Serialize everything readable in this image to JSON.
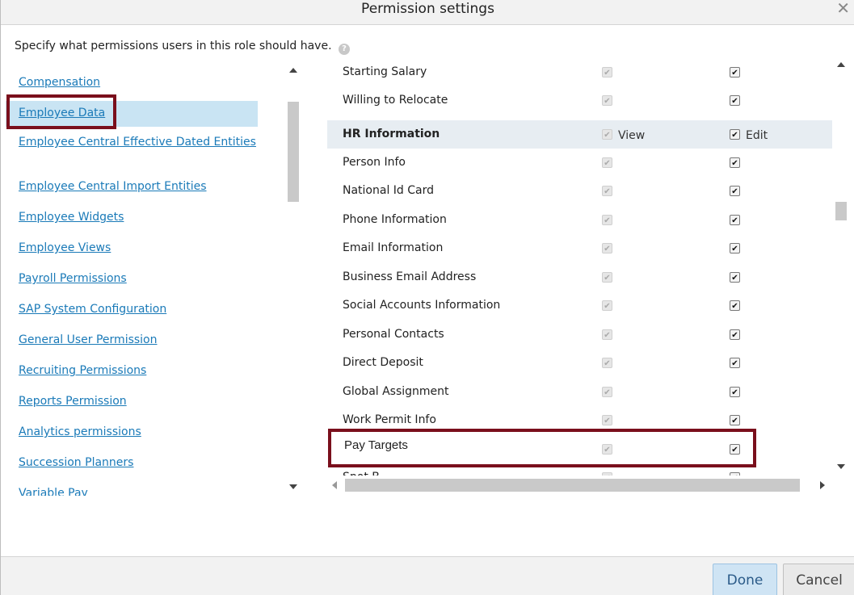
{
  "dialog": {
    "title": "Permission settings",
    "close_symbol": "✕",
    "intro": "Specify what permissions users in this role should have.",
    "help_symbol": "?"
  },
  "nav": {
    "items": [
      {
        "label": "Compensation",
        "selected": false
      },
      {
        "label": "Employee Data",
        "selected": true
      },
      {
        "label": "Employee Central Effective Dated Entities",
        "selected": false
      },
      {
        "label": "Employee Central Import Entities",
        "selected": false
      },
      {
        "label": "Employee Widgets",
        "selected": false
      },
      {
        "label": "Employee Views",
        "selected": false
      },
      {
        "label": "Payroll Permissions",
        "selected": false
      },
      {
        "label": "SAP System Configuration",
        "selected": false
      },
      {
        "label": "General User Permission",
        "selected": false
      },
      {
        "label": "Recruiting Permissions",
        "selected": false
      },
      {
        "label": "Reports Permission",
        "selected": false
      },
      {
        "label": "Analytics permissions",
        "selected": false
      },
      {
        "label": "Succession Planners",
        "selected": false
      },
      {
        "label": "Variable Pay",
        "selected": false
      }
    ]
  },
  "permissions": {
    "view_label": "View",
    "edit_label": "Edit",
    "rows": [
      {
        "label": "Starting Salary",
        "view": true,
        "edit": true,
        "header": false
      },
      {
        "label": "Willing to Relocate",
        "view": true,
        "edit": true,
        "header": false
      },
      {
        "label": "HR Information",
        "view": true,
        "edit": true,
        "header": true
      },
      {
        "label": "Person Info",
        "view": true,
        "edit": true,
        "header": false
      },
      {
        "label": "National Id Card",
        "view": true,
        "edit": true,
        "header": false
      },
      {
        "label": "Phone Information",
        "view": true,
        "edit": true,
        "header": false
      },
      {
        "label": "Email Information",
        "view": true,
        "edit": true,
        "header": false
      },
      {
        "label": "Business Email Address",
        "view": true,
        "edit": true,
        "header": false
      },
      {
        "label": "Social Accounts Information",
        "view": true,
        "edit": true,
        "header": false
      },
      {
        "label": "Personal Contacts",
        "view": true,
        "edit": true,
        "header": false
      },
      {
        "label": "Direct Deposit",
        "view": true,
        "edit": true,
        "header": false
      },
      {
        "label": "Global Assignment",
        "view": true,
        "edit": true,
        "header": false
      },
      {
        "label": "Work Permit Info",
        "view": true,
        "edit": true,
        "header": false
      },
      {
        "label": "Pay Targets",
        "view": true,
        "edit": true,
        "header": false
      },
      {
        "label": "Spot B",
        "view": true,
        "edit": true,
        "header": false
      }
    ]
  },
  "footer": {
    "done_label": "Done",
    "cancel_label": "Cancel"
  },
  "colors": {
    "link": "#1a7ab8",
    "selected_bg": "#c9e4f3",
    "annotation": "#7a0f1c",
    "header_row_bg": "#e7edf2"
  }
}
